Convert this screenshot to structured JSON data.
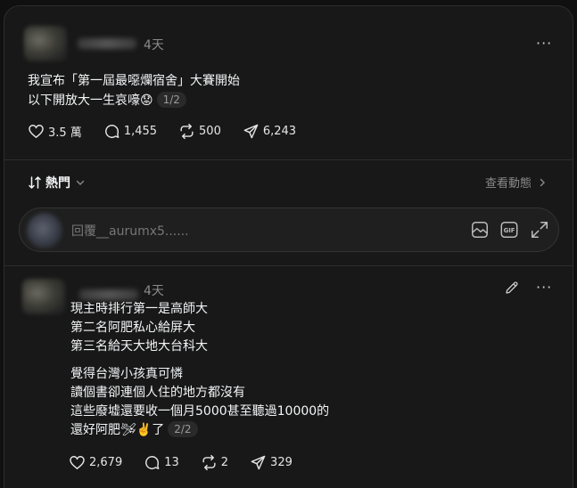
{
  "post": {
    "time": "4天",
    "more": "···",
    "line1": "我宣布「第一屆最噁爛宿舍」大賽開始",
    "line2": "以下開放大一生哀嚎😟",
    "pager": "1/2",
    "likes": "3.5 萬",
    "comments": "1,455",
    "reposts": "500",
    "shares": "6,243"
  },
  "sort_bar": {
    "label": "熱門",
    "activity_label": "查看動態"
  },
  "reply": {
    "placeholder": "回覆__aurumx5......"
  },
  "comment": {
    "time": "4天",
    "more": "···",
    "para1": [
      "現主時排行第一是高師大",
      "第二名阿肥私心給屏大",
      "第三名給天大地大台科大"
    ],
    "para2": [
      "覺得台灣小孩真可憐",
      "讀個書卻連個人住的地方都沒有",
      "這些廢墟還要收一個月5000甚至聽過10000的",
      "還好阿肥🛩✌️了"
    ],
    "pager": "2/2",
    "likes": "2,679",
    "comments": "13",
    "reposts": "2",
    "shares": "329"
  }
}
